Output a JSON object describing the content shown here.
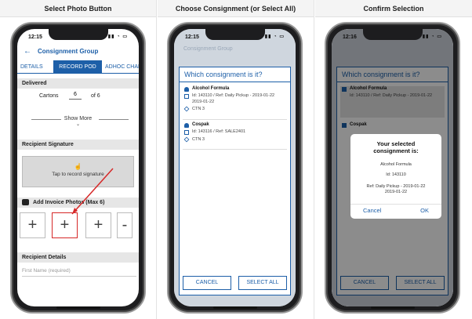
{
  "panels": [
    {
      "title": "Select Photo Button"
    },
    {
      "title": "Choose Consignment (or Select All)"
    },
    {
      "title": "Confirm Selection"
    }
  ],
  "status": {
    "time1": "12:15",
    "time2": "12:15",
    "time3": "12:16"
  },
  "screen1": {
    "header": "Consignment Group",
    "tabs": [
      "DETAILS",
      "RECORD POD",
      "ADHOC CHAR"
    ],
    "delivered_heading": "Delivered",
    "cartons_label": "Cartons",
    "cartons_value": "6",
    "cartons_total": "of 6",
    "show_more": "Show More",
    "signature_heading": "Recipient Signature",
    "signature_prompt": "Tap to record signature",
    "photos_heading": "Add Invoice Photos (Max 6)",
    "details_heading": "Recipient Details",
    "first_name_placeholder": "First Name (required)"
  },
  "screen2": {
    "header": "Consignment Group",
    "sheet_title": "Which consignment is it?",
    "items": [
      {
        "name": "Alcohol Formula",
        "line1": "Id: 143110 / Ref: Daily Pickup - 2019-01-22",
        "line2": "2019-01-22",
        "line3": "CTN 3"
      },
      {
        "name": "Cospak",
        "line1": "Id: 143116 / Ref: SALE2401",
        "line2": "CTN 3"
      }
    ],
    "cancel": "CANCEL",
    "select_all": "SELECT ALL"
  },
  "screen3": {
    "sheet_title": "Which consignment is it?",
    "items": [
      {
        "name": "Alcohol Formula",
        "line1": "Id: 143110 / Ref: Daily Pickup - 2019-01-22"
      },
      {
        "name": "Cospak"
      }
    ],
    "dialog_title": "Your selected consignment is:",
    "dialog_name": "Alcohol Formula",
    "dialog_id": "Id: 143110",
    "dialog_ref": "Ref: Daily Pickup - 2019-01-22",
    "dialog_ref2": "2019-01-22",
    "dialog_cancel": "Cancel",
    "dialog_ok": "OK",
    "cancel": "CANCEL",
    "select_all": "SELECT ALL"
  },
  "colors": {
    "accent": "#1d5fa8",
    "highlight": "#d62828"
  }
}
